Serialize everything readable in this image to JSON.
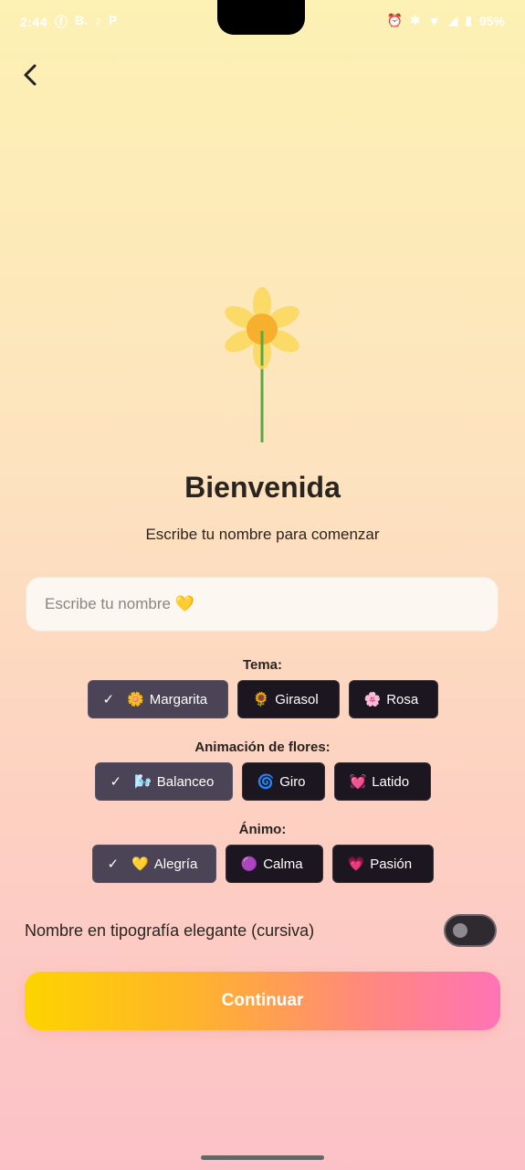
{
  "status_bar": {
    "time": "2:44",
    "left_icons": [
      "facebook-icon",
      "b-icon",
      "tiktok-icon",
      "p-icon"
    ],
    "left_icon_glyphs": [
      "ⓕ",
      "B.",
      "♪",
      "P"
    ],
    "right_icons": [
      "alarm-icon",
      "vibrate-icon",
      "data-icon",
      "wifi-icon",
      "signal-icon",
      "battery-icon"
    ],
    "battery": "95%"
  },
  "header": {
    "back_icon": "chevron-left-icon"
  },
  "welcome": {
    "title": "Bienvenida",
    "subtitle": "Escribe tu nombre para comenzar"
  },
  "name_input": {
    "placeholder": "Escribe tu nombre 💛",
    "value": ""
  },
  "theme": {
    "label": "Tema:",
    "options": [
      {
        "emoji": "🌼",
        "label": "Margarita",
        "selected": true
      },
      {
        "emoji": "🌻",
        "label": "Girasol",
        "selected": false
      },
      {
        "emoji": "🌸",
        "label": "Rosa",
        "selected": false
      }
    ]
  },
  "animation": {
    "label": "Animación de flores:",
    "options": [
      {
        "emoji": "🌬️",
        "label": "Balanceo",
        "selected": true
      },
      {
        "emoji": "🌀",
        "label": "Giro",
        "selected": false
      },
      {
        "emoji": "💓",
        "label": "Latido",
        "selected": false
      }
    ]
  },
  "mood": {
    "label": "Ánimo:",
    "options": [
      {
        "emoji": "💛",
        "label": "Alegría",
        "selected": true
      },
      {
        "emoji": "🟣",
        "label": "Calma",
        "selected": false
      },
      {
        "emoji": "💗",
        "label": "Pasión",
        "selected": false
      }
    ]
  },
  "cursive_toggle": {
    "label": "Nombre en tipografía elegante (cursiva)",
    "on": false
  },
  "continue_button": {
    "label": "Continuar"
  },
  "colors": {
    "petal": "#fbd85a",
    "center": "#f7b02e",
    "stem": "#5aa844",
    "button_start": "#fdd400",
    "button_end": "#ff73b6"
  }
}
